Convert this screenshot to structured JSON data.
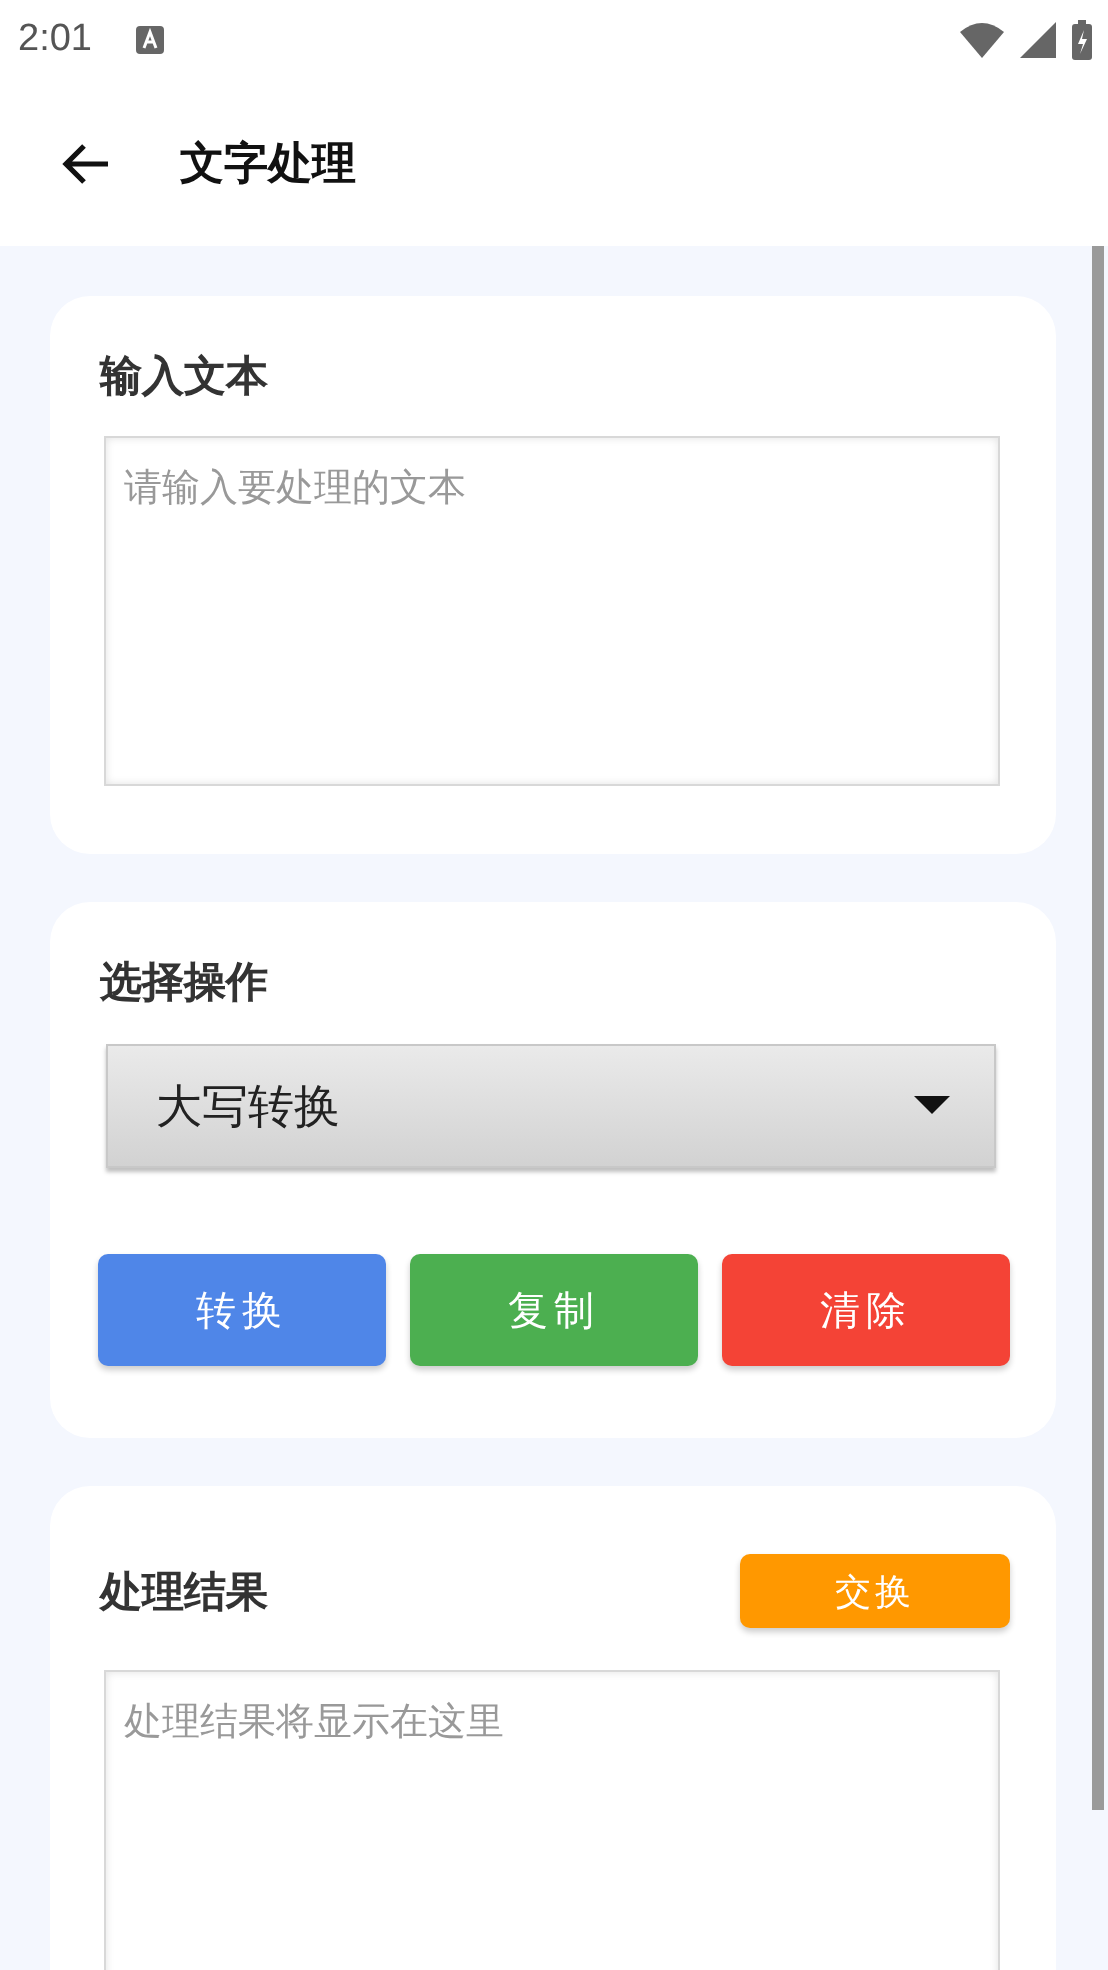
{
  "status_bar": {
    "time": "2:01"
  },
  "app_bar": {
    "title": "文字处理"
  },
  "input_card": {
    "title": "输入文本",
    "placeholder": "请输入要处理的文本"
  },
  "operation_card": {
    "title": "选择操作",
    "selected_operation": "大写转换",
    "buttons": [
      {
        "label": "转换",
        "color": "#4f86e8"
      },
      {
        "label": "复制",
        "color": "#4caf50"
      },
      {
        "label": "清除",
        "color": "#f44336"
      }
    ]
  },
  "result_card": {
    "title": "处理结果",
    "swap_button": "交换",
    "placeholder": "处理结果将显示在这里"
  }
}
